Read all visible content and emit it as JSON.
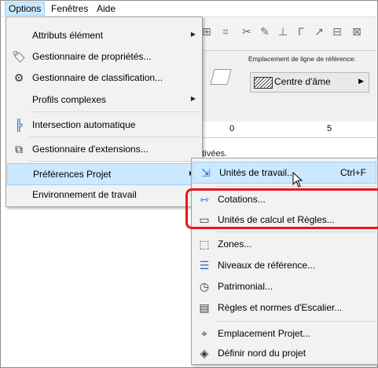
{
  "menubar": {
    "items": [
      {
        "label": "Options",
        "active": true
      },
      {
        "label": "Fenêtres",
        "active": false
      },
      {
        "label": "Aide",
        "active": false
      }
    ]
  },
  "background": {
    "reference_line_label": "Emplacement de ligne de référence:",
    "reference_line_value": "Centre d'âme",
    "ruler_ticks": [
      "0",
      "5"
    ],
    "status_text": "désactivées."
  },
  "options_menu": {
    "items": [
      {
        "label": "Attributs élément",
        "icon": "none",
        "has_submenu": true
      },
      {
        "label": "Gestionnaire de propriétés...",
        "icon": "tag-icon",
        "has_submenu": false
      },
      {
        "label": "Gestionnaire de classification...",
        "icon": "classification-icon",
        "has_submenu": false
      },
      {
        "label": "Profils complexes",
        "icon": "none",
        "has_submenu": true
      },
      {
        "label": "Intersection automatique",
        "icon": "intersection-icon",
        "has_submenu": false
      },
      {
        "label": "Gestionnaire d'extensions...",
        "icon": "extension-icon",
        "has_submenu": false
      },
      {
        "label": "Préférences Projet",
        "icon": "none",
        "has_submenu": true,
        "highlighted": true
      },
      {
        "label": "Environnement de travail",
        "icon": "none",
        "has_submenu": true
      }
    ]
  },
  "preferences_submenu": {
    "items": [
      {
        "label": "Unités de travail...",
        "shortcut": "Ctrl+F",
        "icon": "units-icon",
        "highlighted": true
      },
      {
        "label": "Cotations...",
        "icon": "dimensions-icon"
      },
      {
        "label": "Unités de calcul et Règles...",
        "icon": "calculation-icon"
      },
      {
        "label": "Zones...",
        "icon": "zones-icon"
      },
      {
        "label": "Niveaux de référence...",
        "icon": "reference-levels-icon"
      },
      {
        "label": "Patrimonial...",
        "icon": "heritage-icon"
      },
      {
        "label": "Règles et normes d'Escalier...",
        "icon": "stair-rules-icon"
      },
      {
        "label": "Emplacement Projet...",
        "icon": "location-icon"
      },
      {
        "label": "Définir nord du projet",
        "icon": "north-icon"
      }
    ]
  },
  "colors": {
    "menu_highlight": "#cce8ff",
    "annotation_red": "#e8161f"
  }
}
